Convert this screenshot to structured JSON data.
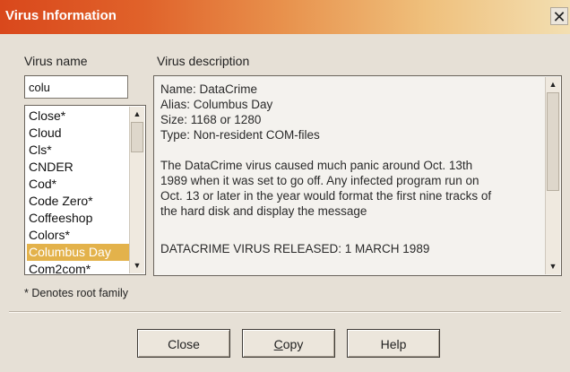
{
  "window": {
    "title": "Virus Information",
    "close_glyph": "✕"
  },
  "left": {
    "virus_name_label": "Virus name",
    "search_value": "colu",
    "items": [
      "Close*",
      "Cloud",
      "Cls*",
      "CNDER",
      "Cod*",
      "Code Zero*",
      "Coffeeshop",
      "Colors*",
      "Columbus Day",
      "Com2com*"
    ],
    "selected_item": "Columbus Day",
    "footnote": "* Denotes root family"
  },
  "description": {
    "label": "Virus description",
    "lines": [
      "Name: DataCrime",
      "Alias: Columbus Day",
      "Size: 1168 or 1280",
      "Type: Non-resident  COM-files",
      "",
      "The DataCrime virus caused much panic around Oct. 13th",
      "1989 when it was set to go off.  Any infected program run on",
      "Oct. 13 or later in the year would format the first nine tracks of",
      "the hard disk and display the message",
      "",
      "DATACRIME VIRUS RELEASED: 1 MARCH 1989"
    ]
  },
  "buttons": {
    "close": "Close",
    "copy_prefix": "",
    "copy_accel": "C",
    "copy_rest": "opy",
    "help": "Help"
  },
  "icons": {
    "scroll_up": "scroll-up-icon",
    "scroll_down": "scroll-down-icon",
    "close": "close-icon"
  },
  "colors": {
    "selection": "#e3b24b",
    "titlebar_start": "#d9481c",
    "titlebar_end": "#f3dfb2"
  }
}
